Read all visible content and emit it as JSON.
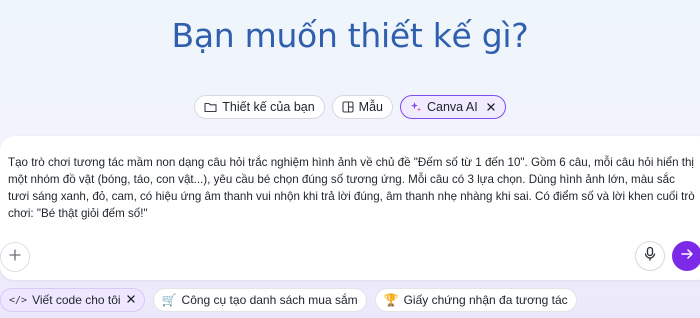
{
  "hero": {
    "title": "Bạn muốn thiết kế gì?"
  },
  "mode_tabs": [
    {
      "label": "Thiết kế của bạn",
      "icon": "folder-icon",
      "active": false
    },
    {
      "label": "Mẫu",
      "icon": "template-icon",
      "active": false
    },
    {
      "label": "Canva AI",
      "icon": "sparkle-icon",
      "active": true
    }
  ],
  "composer": {
    "prompt_text": "Tạo trò chơi tương tác mầm non dạng câu hỏi trắc nghiệm hình ảnh về chủ đề \"Đếm số từ 1 đến 10\". Gồm 6 câu, mỗi câu hỏi hiển thị một nhóm đồ vật (bóng, táo, con vật...), yêu cầu bé chọn đúng số tương ứng. Mỗi câu có 3 lựa chọn. Dùng hình ảnh lớn, màu sắc tươi sáng xanh, đỏ, cam, có hiệu ứng âm thanh vui nhộn khi trả lời đúng, âm thanh nhẹ nhàng khi sai. Có điểm số và lời khen cuối trò chơi: \"Bé thật giỏi đếm số!\"",
    "add_icon": "plus-icon",
    "mic_icon": "microphone-icon",
    "send_icon": "arrow-right-icon"
  },
  "suggestions": [
    {
      "label": "Viết code cho tôi",
      "icon": "code-icon",
      "active": true
    },
    {
      "label": "Công cụ tạo danh sách mua sắm",
      "icon": "shopping-cart-icon",
      "active": false
    },
    {
      "label": "Giấy chứng nhận đa tương tác",
      "icon": "trophy-icon",
      "active": false
    }
  ],
  "colors": {
    "accent": "#7d2ae8",
    "title": "#2f5fae",
    "active_border": "#7d4df0"
  }
}
